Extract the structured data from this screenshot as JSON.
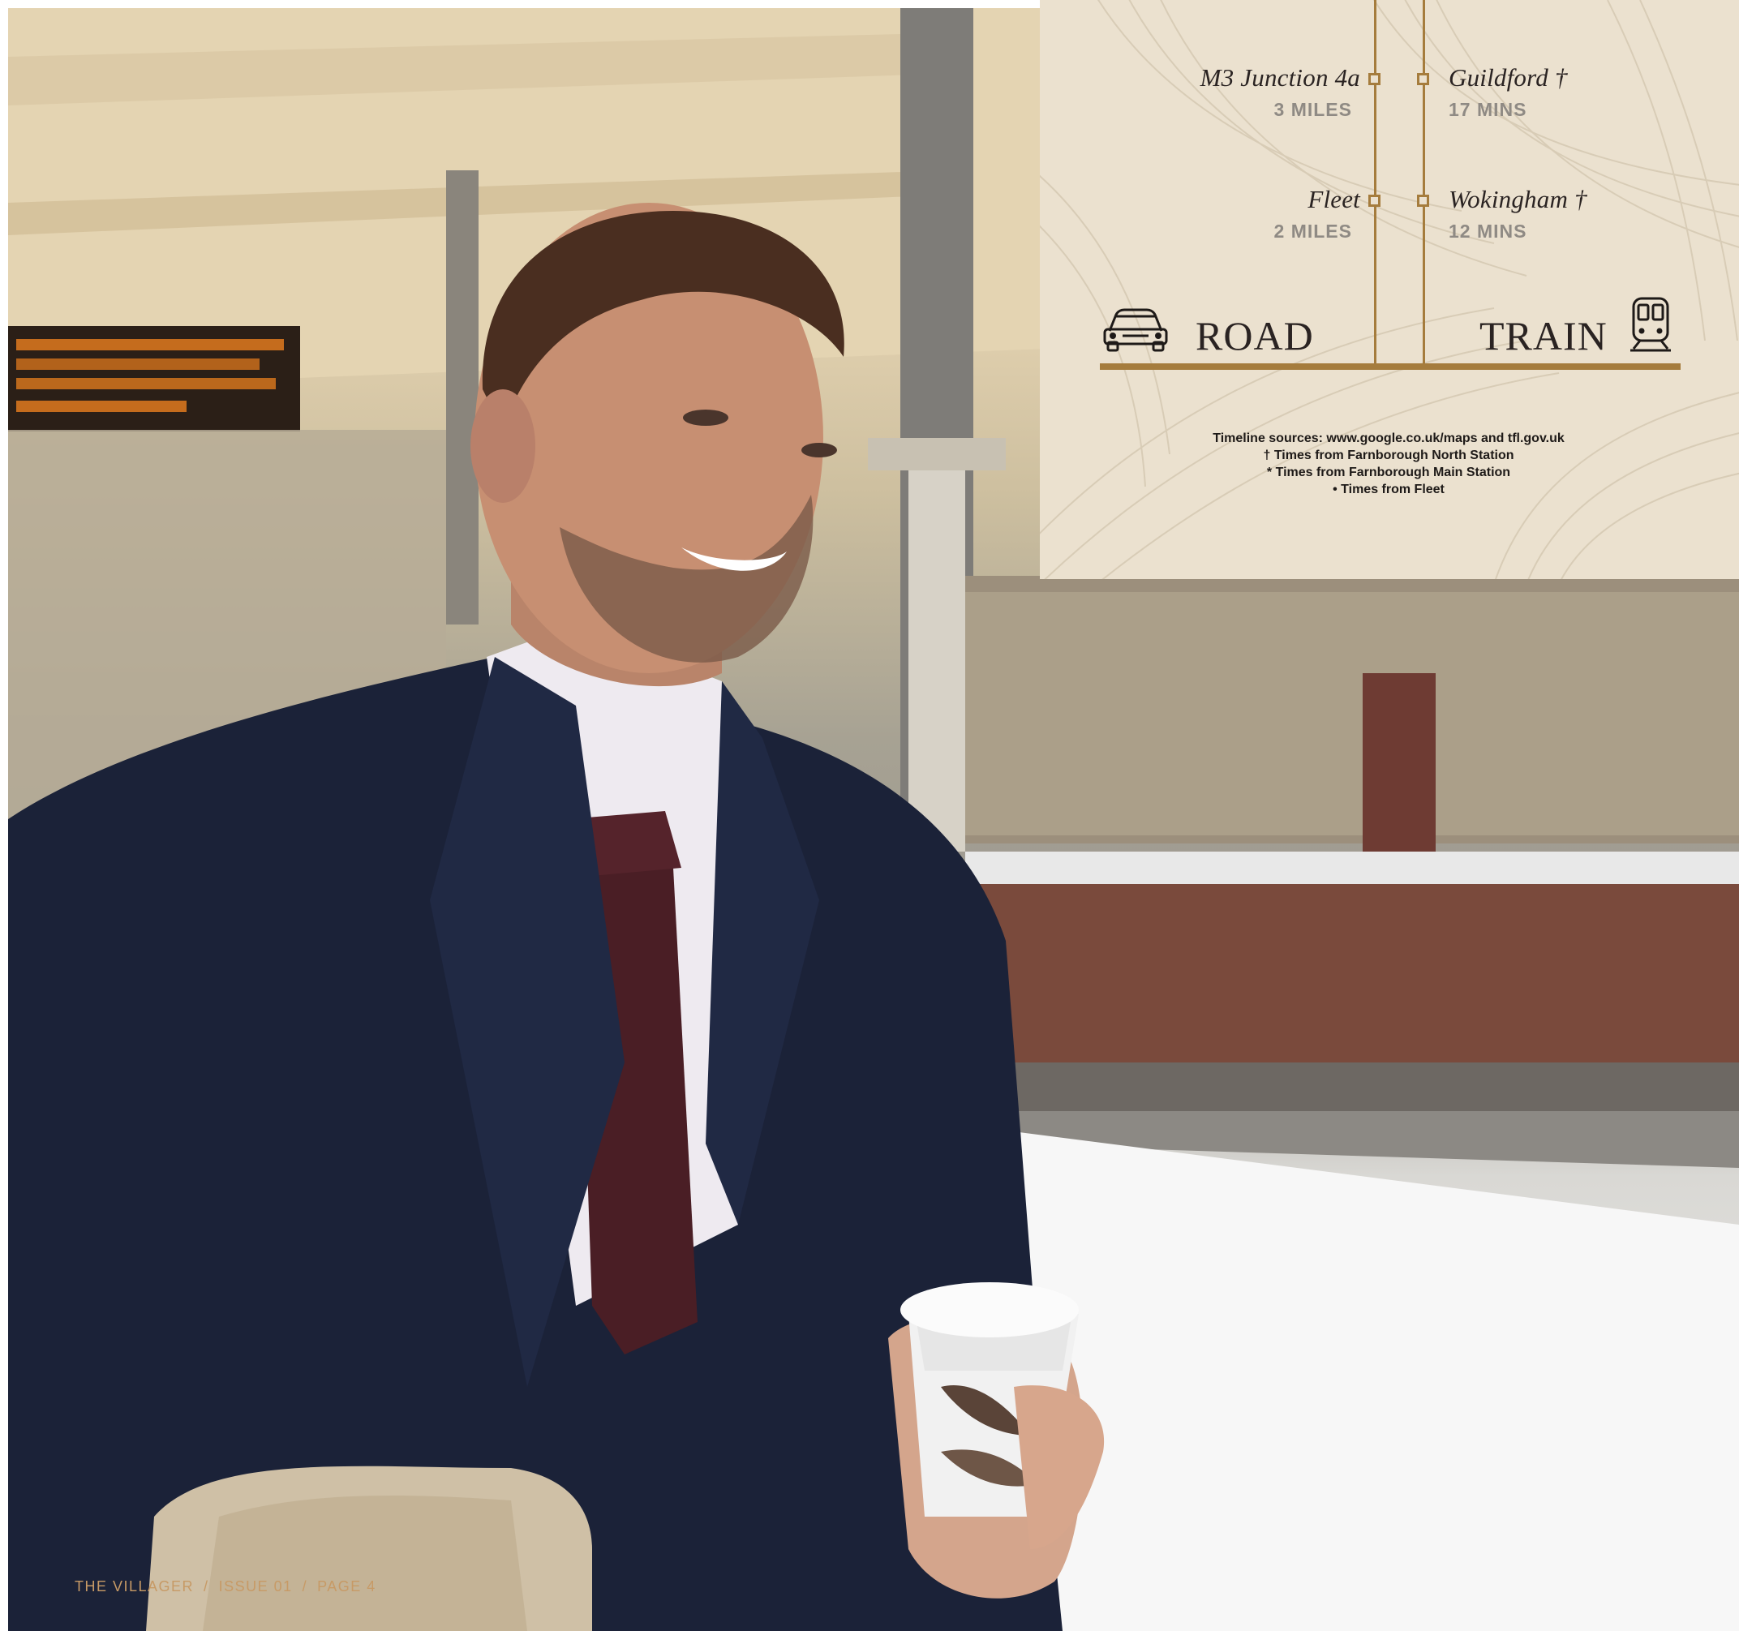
{
  "panel": {
    "road": {
      "label": "ROAD",
      "icon": "car-icon",
      "stops": [
        {
          "place": "M3 Junction 4a",
          "distance": "3 MILES"
        },
        {
          "place": "Fleet",
          "distance": "2 MILES"
        }
      ]
    },
    "train": {
      "label": "TRAIN",
      "icon": "train-icon",
      "stops": [
        {
          "place": "Guildford †",
          "time": "17 MINS"
        },
        {
          "place": "Wokingham †",
          "time": "12 MINS"
        }
      ]
    },
    "sources": [
      "Timeline sources: www.google.co.uk/maps and tfl.gov.uk",
      "† Times from Farnborough North Station",
      "* Times from Farnborough Main Station",
      "• Times from Fleet"
    ],
    "accent_color": "#a57c3d",
    "background_color": "#ebe1cf"
  },
  "footer": {
    "publication": "THE VILLAGER",
    "separator": "/",
    "issue": "ISSUE 01",
    "page": "PAGE 4"
  }
}
